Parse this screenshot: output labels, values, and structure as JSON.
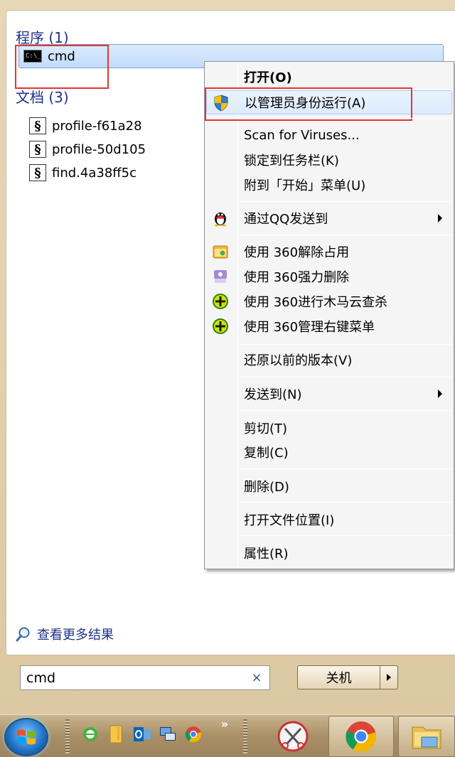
{
  "results": {
    "programs_title": "程序 (1)",
    "programs": [
      {
        "label": "cmd",
        "icon": "console-icon"
      }
    ],
    "documents_title": "文档 (3)",
    "documents": [
      {
        "label": "profile-f61a28",
        "icon": "script-file-icon"
      },
      {
        "label": "profile-50d105",
        "icon": "script-file-icon"
      },
      {
        "label": "find.4a38ff5c",
        "icon": "script-file-icon"
      }
    ],
    "see_more": "查看更多结果"
  },
  "search": {
    "value": "cmd",
    "clear_glyph": "×"
  },
  "shutdown": {
    "label": "关机"
  },
  "context_menu": {
    "items": [
      {
        "label": "打开(O)",
        "bold": true
      },
      {
        "label": "以管理员身份运行(A)",
        "icon": "uac-shield-icon",
        "highlighted": true
      },
      {
        "label": "Scan for Viruses..."
      },
      {
        "label": "锁定到任务栏(K)"
      },
      {
        "label": "附到「开始」菜单(U)"
      },
      {
        "label": "通过QQ发送到",
        "icon": "qq-penguin-icon",
        "submenu": true
      },
      {
        "label": "使用 360解除占用",
        "icon": "360-unlock-icon"
      },
      {
        "label": "使用 360强力删除",
        "icon": "360-shred-icon"
      },
      {
        "label": "使用 360进行木马云查杀",
        "icon": "360-plus-icon"
      },
      {
        "label": "使用 360管理右键菜单",
        "icon": "360-plus-icon"
      },
      {
        "label": "还原以前的版本(V)"
      },
      {
        "label": "发送到(N)",
        "submenu": true
      },
      {
        "label": "剪切(T)"
      },
      {
        "label": "复制(C)"
      },
      {
        "label": "删除(D)"
      },
      {
        "label": "打开文件位置(I)"
      },
      {
        "label": "属性(R)"
      }
    ]
  },
  "colors": {
    "highlight_box": "#e23636",
    "section_title": "#1e3287",
    "accent": "#c1dcfc"
  },
  "taskbar": {
    "items": [
      "start-orb-icon",
      "ie-icon",
      "folder-icon",
      "outlook-icon",
      "remote-desktop-icon",
      "chrome-icon",
      "more-chevron-icon",
      "snipping-tool-icon",
      "chrome-icon",
      "file-explorer-icon"
    ]
  }
}
